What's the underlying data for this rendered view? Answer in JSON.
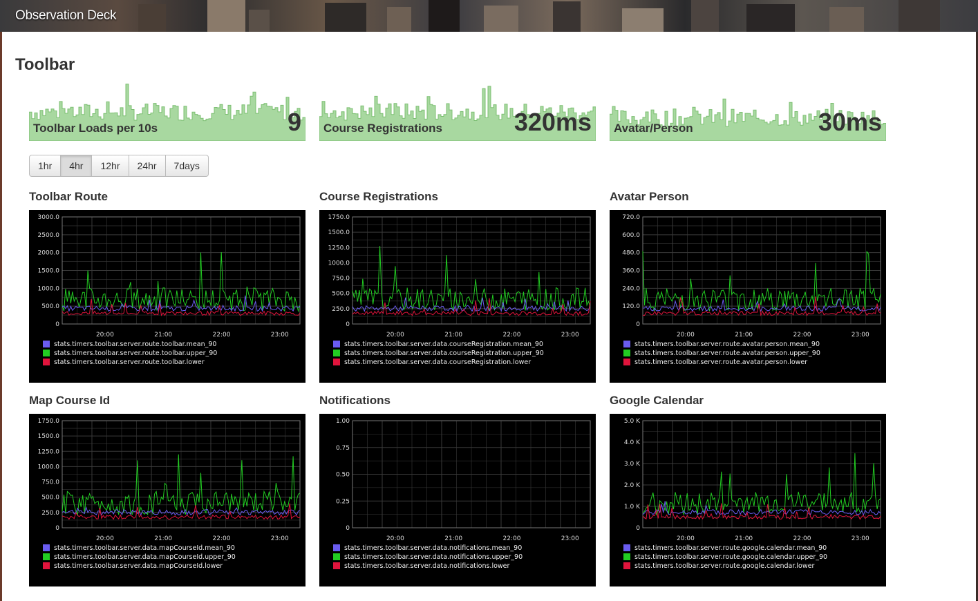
{
  "app": {
    "title": "Observation Deck"
  },
  "section": {
    "title": "Toolbar"
  },
  "colors": {
    "spark": "#a8d8a0",
    "sparkLine": "#7cbf72",
    "mean": "#6a5cf0",
    "upper": "#22cc22",
    "lower": "#e0143c",
    "grid": "#3a3a3a"
  },
  "sparklines": [
    {
      "label": "Toolbar Loads per 10s",
      "value": "9"
    },
    {
      "label": "Course Registrations",
      "value": "320ms"
    },
    {
      "label": "Avatar/Person",
      "value": "30ms"
    }
  ],
  "timeRanges": {
    "items": [
      "1hr",
      "4hr",
      "12hr",
      "24hr",
      "7days"
    ],
    "selected": "4hr"
  },
  "charts": [
    {
      "title": "Toolbar Route",
      "y_ticks": [
        "3000.0",
        "2500.0",
        "2000.0",
        "1500.0",
        "1000.0",
        "500.0",
        "0"
      ],
      "x_ticks": [
        "20:00",
        "21:00",
        "22:00",
        "23:00"
      ],
      "legend": [
        "stats.timers.toolbar.server.route.toolbar.mean_90",
        "stats.timers.toolbar.server.route.toolbar.upper_90",
        "stats.timers.toolbar.server.route.toolbar.lower"
      ]
    },
    {
      "title": "Course Registrations",
      "y_ticks": [
        "1750.0",
        "1500.0",
        "1250.0",
        "1000.0",
        "750.0",
        "500.0",
        "250.0",
        "0"
      ],
      "x_ticks": [
        "20:00",
        "21:00",
        "22:00",
        "23:00"
      ],
      "legend": [
        "stats.timers.toolbar.server.data.courseRegistration.mean_90",
        "stats.timers.toolbar.server.data.courseRegistration.upper_90",
        "stats.timers.toolbar.server.data.courseRegistration.lower"
      ]
    },
    {
      "title": "Avatar Person",
      "y_ticks": [
        "720.0",
        "600.0",
        "480.0",
        "360.0",
        "240.0",
        "120.0",
        "0"
      ],
      "x_ticks": [
        "20:00",
        "21:00",
        "22:00",
        "23:00"
      ],
      "legend": [
        "stats.timers.toolbar.server.route.avatar.person.mean_90",
        "stats.timers.toolbar.server.route.avatar.person.upper_90",
        "stats.timers.toolbar.server.route.avatar.person.lower"
      ]
    },
    {
      "title": "Map Course Id",
      "y_ticks": [
        "1750.0",
        "1500.0",
        "1250.0",
        "1000.0",
        "750.0",
        "500.0",
        "250.0",
        "0"
      ],
      "x_ticks": [
        "20:00",
        "21:00",
        "22:00",
        "23:00"
      ],
      "legend": [
        "stats.timers.toolbar.server.data.mapCourseId.mean_90",
        "stats.timers.toolbar.server.data.mapCourseId.upper_90",
        "stats.timers.toolbar.server.data.mapCourseId.lower"
      ]
    },
    {
      "title": "Notifications",
      "y_ticks": [
        "1.00",
        "0.75",
        "0.50",
        "0.25",
        "0"
      ],
      "x_ticks": [
        "20:00",
        "21:00",
        "22:00",
        "23:00"
      ],
      "legend": [
        "stats.timers.toolbar.server.data.notifications.mean_90",
        "stats.timers.toolbar.server.data.notifications.upper_90",
        "stats.timers.toolbar.server.data.notifications.lower"
      ]
    },
    {
      "title": "Google Calendar",
      "y_ticks": [
        "5.0 K",
        "4.0 K",
        "3.0 K",
        "2.0 K",
        "1.0 K",
        "0"
      ],
      "x_ticks": [
        "20:00",
        "21:00",
        "22:00",
        "23:00"
      ],
      "legend": [
        "stats.timers.toolbar.server.route.google.calendar.mean_90",
        "stats.timers.toolbar.server.route.google.calendar.upper_90",
        "stats.timers.toolbar.server.route.google.calendar.lower"
      ]
    }
  ]
}
